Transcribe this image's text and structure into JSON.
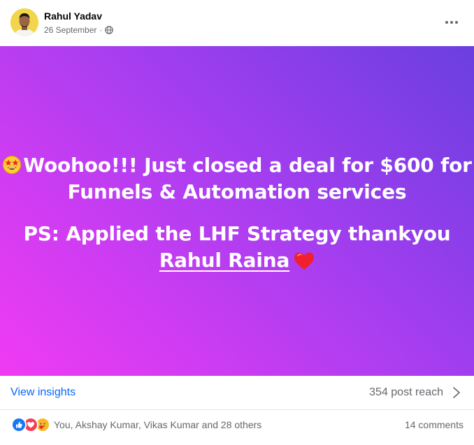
{
  "post": {
    "author": "Rahul Yadav",
    "date": "26 September",
    "meta_separator": "·",
    "privacy_icon": "globe-icon",
    "more_icon": "more-horizontal-icon"
  },
  "banner": {
    "line1_emoji": "star-struck-emoji",
    "line1_text": "Woohoo!!! Just closed a deal for $600 for Funnels & Automation services",
    "line2_text": "PS: Applied the LHF Strategy thankyou ",
    "mention": "Rahul Raina",
    "line2_emoji": "red-heart-emoji",
    "gradient_colors": [
      "#6a3fe0",
      "#a63ef0",
      "#d13cf2",
      "#ef3bf3"
    ]
  },
  "insights": {
    "link_label": "View insights",
    "reach": "354 post reach",
    "chevron_icon": "chevron-right-icon",
    "link_color": "#0866ff"
  },
  "engagement": {
    "reaction_icons": [
      "like-icon",
      "love-icon",
      "care-icon"
    ],
    "reactors_text": "You, Akshay Kumar, Vikas Kumar and 28 others",
    "comments": "14 comments"
  }
}
